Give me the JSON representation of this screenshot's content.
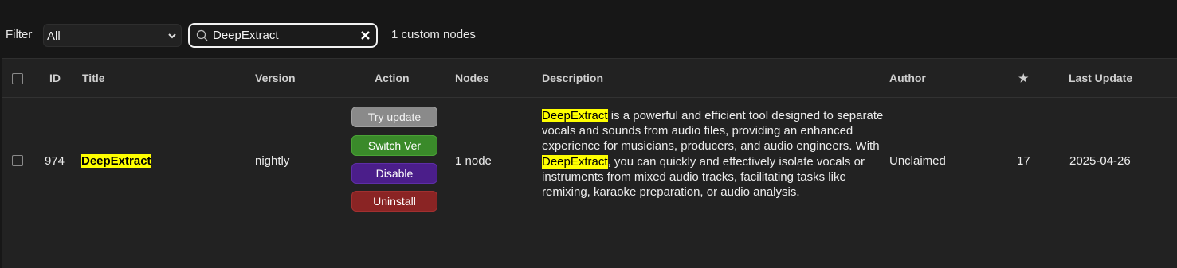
{
  "toolbar": {
    "filter_label": "Filter",
    "filter_value": "All",
    "search_value": "DeepExtract",
    "result_count": "1 custom nodes"
  },
  "table": {
    "columns": [
      "ID",
      "Title",
      "Version",
      "Action",
      "Nodes",
      "Description",
      "Author",
      "★",
      "Last Update"
    ],
    "rows": [
      {
        "id": "974",
        "title": "DeepExtract",
        "version": "nightly",
        "actions": [
          "Try update",
          "Switch Ver",
          "Disable",
          "Uninstall"
        ],
        "nodes": "1 node",
        "description": {
          "hl1": "DeepExtract",
          "part1": " is a powerful and efficient tool designed to separate vocals and sounds from audio files, providing an enhanced experience for musicians, producers, and audio engineers. With ",
          "hl2": "DeepExtract",
          "part2": ", you can quickly and effectively isolate vocals or instruments from mixed audio tracks, facilitating tasks like remixing, karaoke preparation, or audio analysis."
        },
        "author": "Unclaimed",
        "stars": "17",
        "last_update": "2025-04-26"
      }
    ]
  },
  "colors": {
    "highlight": "#ffff00",
    "try_update": "#8a8a8a",
    "switch_ver": "#3a8a2a",
    "disable": "#4b1e8a",
    "uninstall": "#8a2424"
  },
  "icons": [
    "search-icon",
    "clear-icon",
    "chevron-down-icon"
  ]
}
